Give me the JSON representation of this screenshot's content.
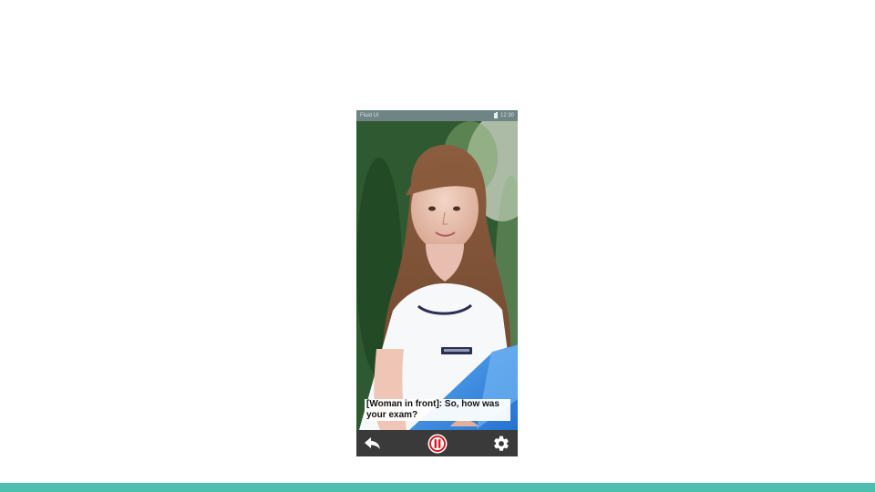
{
  "colors": {
    "accent_bar": "#4dbfb0",
    "status_bar": "#6f8485",
    "control_bar": "#3a3a3a",
    "pause_red": "#d42026"
  },
  "phone": {
    "status_bar": {
      "app_name": "Fluid UI",
      "time": "12:30",
      "battery_icon": "battery-icon"
    },
    "camera_view": {
      "caption": "[Woman in front]: So, how was your exam?"
    },
    "controls": {
      "back_icon": "reply-arrow-icon",
      "pause_icon": "pause-icon",
      "settings_icon": "gear-icon"
    }
  }
}
